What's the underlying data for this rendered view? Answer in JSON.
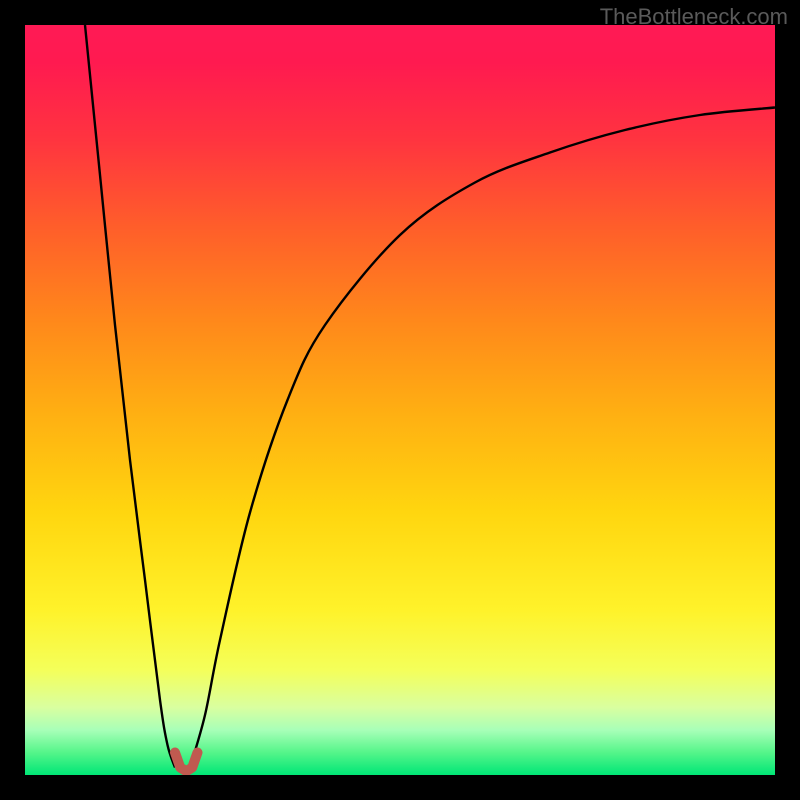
{
  "watermark": "TheBottleneck.com",
  "chart_data": {
    "type": "line",
    "title": "",
    "xlabel": "",
    "ylabel": "",
    "xlim": [
      0,
      100
    ],
    "ylim": [
      0,
      100
    ],
    "grid": false,
    "legend": false,
    "gradient_colors": {
      "top": "#ff1a55",
      "mid": "#ffd60f",
      "bottom": "#00e676"
    },
    "series": [
      {
        "name": "left-branch",
        "stroke": "#000000",
        "x": [
          8,
          10,
          12,
          14,
          16,
          18,
          19,
          20
        ],
        "y": [
          100,
          80,
          60,
          42,
          26,
          10,
          4,
          1
        ]
      },
      {
        "name": "right-branch",
        "stroke": "#000000",
        "x": [
          22,
          24,
          26,
          30,
          35,
          40,
          50,
          60,
          70,
          80,
          90,
          100
        ],
        "y": [
          1,
          8,
          18,
          35,
          50,
          60,
          72,
          79,
          83,
          86,
          88,
          89
        ]
      },
      {
        "name": "bottom-marker",
        "stroke": "#c05a50",
        "x": [
          20,
          20.7,
          21.5,
          22.3,
          23
        ],
        "y": [
          3,
          1,
          0.5,
          1,
          3
        ]
      }
    ]
  }
}
